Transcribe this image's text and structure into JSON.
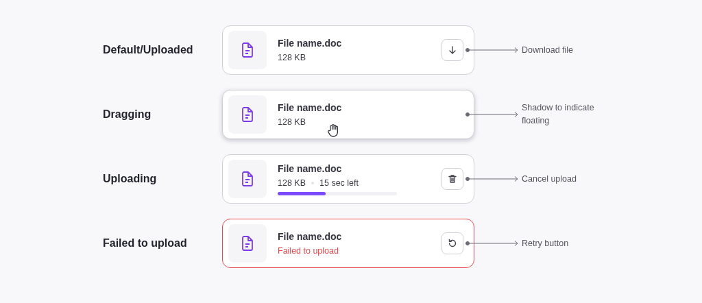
{
  "rows": [
    {
      "kind": "default",
      "label": "Default/Uploaded",
      "file_name": "File name.doc",
      "size": "128 KB",
      "action": {
        "kind": "download"
      },
      "annotation": "Download file"
    },
    {
      "kind": "dragging",
      "label": "Dragging",
      "file_name": "File name.doc",
      "size": "128 KB",
      "annotation": "Shadow to indicate floating"
    },
    {
      "kind": "uploading",
      "label": "Uploading",
      "file_name": "File name.doc",
      "size": "128 KB",
      "time_left": "15 sec left",
      "level": 0.4,
      "action": {
        "kind": "delete"
      },
      "annotation": "Cancel upload"
    },
    {
      "kind": "failed",
      "label": "Failed to upload",
      "file_name": "File name.doc",
      "error": "Failed to upload",
      "action": {
        "kind": "retry"
      },
      "annotation": "Retry button"
    }
  ]
}
